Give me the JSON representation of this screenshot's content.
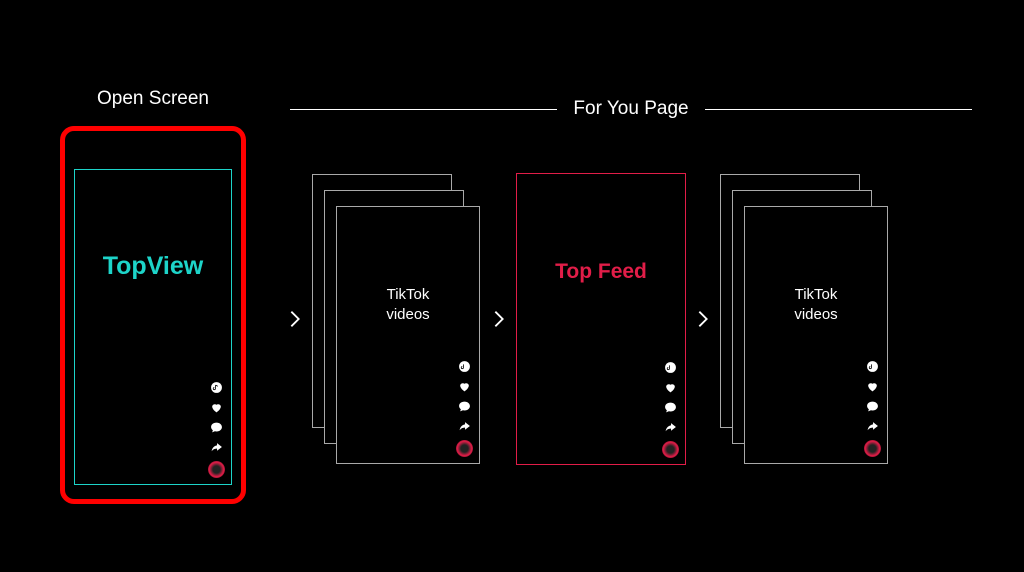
{
  "sections": {
    "open_screen": {
      "label": "Open Screen",
      "card_label": "TopView"
    },
    "for_you": {
      "label": "For You Page",
      "stack1_label": "TikTok\nvideos",
      "topfeed_label": "Top Feed",
      "stack2_label": "TikTok\nvideos"
    }
  },
  "colors": {
    "highlight_frame": "#ff0000",
    "topview": "#1dd4c9",
    "topfeed": "#e11d48",
    "bg": "#000000",
    "line": "#ffffff"
  },
  "icons": [
    "music-note",
    "heart",
    "comment",
    "share",
    "spinning-record"
  ]
}
